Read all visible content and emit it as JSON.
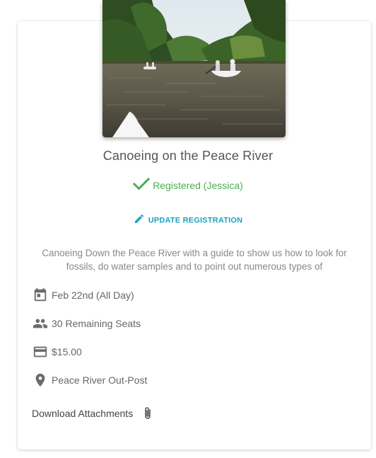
{
  "event": {
    "title": "Canoeing on the Peace River",
    "registration_status": "Registered (Jessica)",
    "update_label": "UPDATE REGISTRATION",
    "description": "Canoeing Down the Peace River with a guide to show us how to look for fossils, do water samples and to point out numerous types of",
    "date": "Feb 22nd (All Day)",
    "seats": "30 Remaining Seats",
    "price": "$15.00",
    "location": "Peace River Out-Post",
    "attachments_label": "Download Attachments"
  },
  "icons": {
    "registered": "check-icon",
    "update": "pencil-icon",
    "date": "calendar-icon",
    "seats": "people-icon",
    "price": "credit-card-icon",
    "location": "location-pin-icon",
    "attachments": "paperclip-icon"
  },
  "colors": {
    "registered_green": "#4caf50",
    "accent_teal": "#1ba3c2",
    "icon_gray": "#6b6b6b"
  }
}
